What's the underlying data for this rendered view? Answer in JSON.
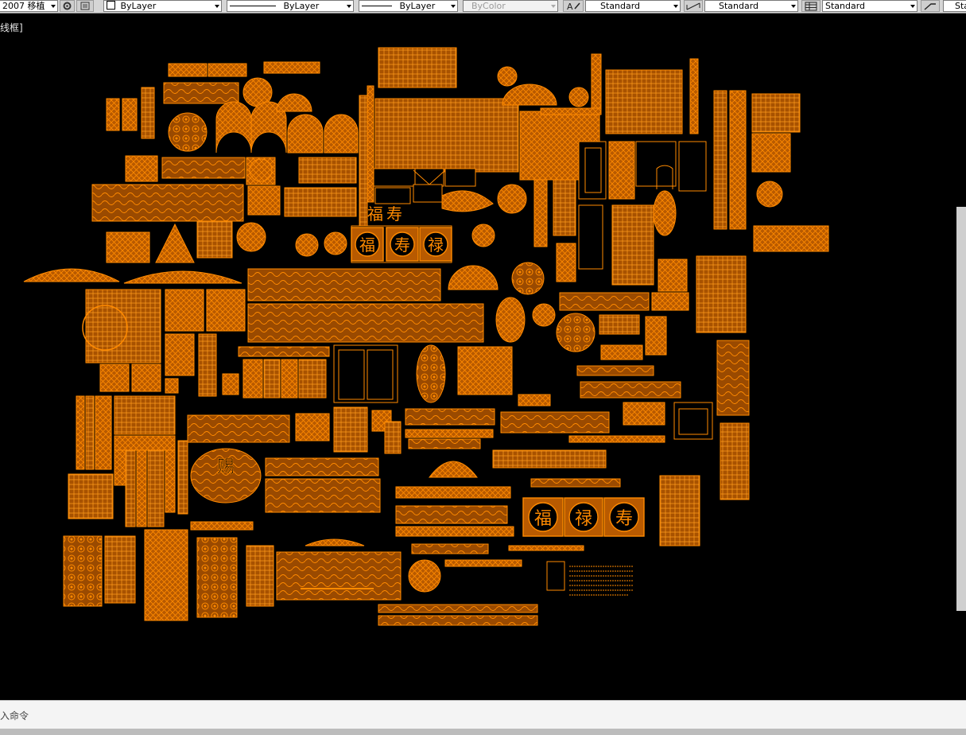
{
  "toolbar": {
    "workspace_label": "2007 移植",
    "color_label": "ByLayer",
    "linetype_label": "ByLayer",
    "lineweight_label": "ByLayer",
    "plotstyle_label": "ByColor",
    "text_style_label": "Standard",
    "dim_style_label": "Standard",
    "table_style_label": "Standard",
    "multileader_style_label": "Sta"
  },
  "viewport": {
    "view_label": "线框]"
  },
  "canvas": {
    "background": "#000000",
    "stroke_color": "#ff8a00",
    "fill_color": "#b85a00",
    "large_chars_row1": [
      "福",
      "寿",
      "禄"
    ],
    "large_chars_row2": [
      "福",
      "禄",
      "寿"
    ],
    "mid_chars": [
      "福",
      "寿"
    ],
    "seal_char": "赐"
  },
  "command_line": {
    "prompt": "入命令"
  }
}
